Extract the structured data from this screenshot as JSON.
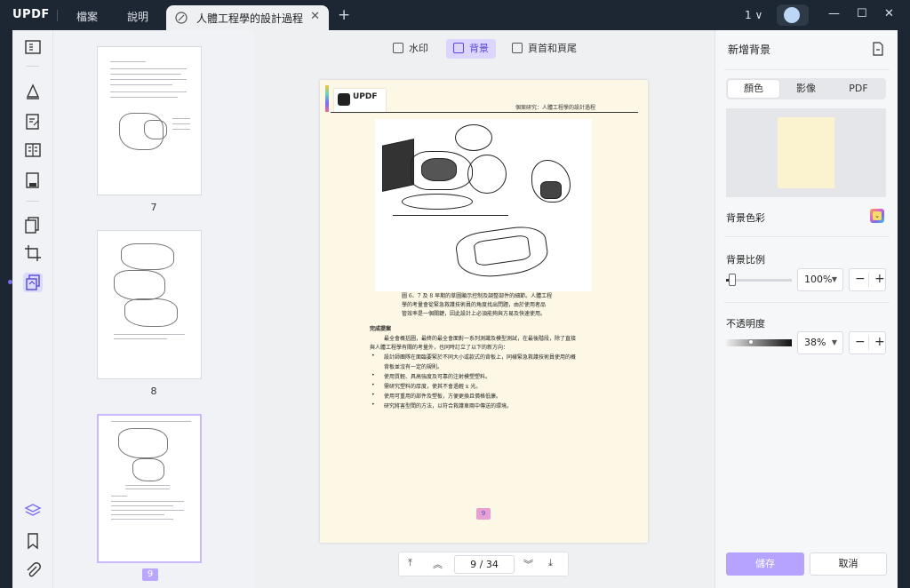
{
  "titlebar": {
    "logo": "UPDF",
    "menu": [
      "檔案",
      "說明"
    ],
    "tab_title": "人體工程學的設計過程",
    "page_count": "1 ∨"
  },
  "thumbnails": [
    {
      "label": "7"
    },
    {
      "label": "8"
    },
    {
      "label": "9"
    }
  ],
  "page_tabs": {
    "watermark": "水印",
    "background": "背景",
    "header_footer": "頁首和頁尾"
  },
  "document": {
    "logo_text": "UPDF",
    "header": "個案研究：人體工程學的設計過程",
    "caption": [
      "圖 6、7 及 8  早期的草圖顯示控制及調整部件的細節。人體工程",
      "學的考量會從緊急救護技術員的角度找出問題，由於使用者品",
      "管效率是一個關鍵，因此設計上必須能夠與方易及快速使用。"
    ],
    "section_title": "完成提案",
    "paragraph": [
      "最全會概括圖，最終的最全會面對一系列測識及模型測試，在最後階段，除了直接",
      "與人體工程學有關的考量外，也同時訂立了以下的新方向："
    ],
    "bullets": [
      "設計師團隊在面臨要緊於不同大小或款式的背板上，同樣緊急救護技術員使用的概",
      "使用質輕、具高強度及可靠的注射模塑塑料。",
      "需研究塑料的厚度，使其不會過輕 x 光。",
      "使用可重用的部件及塑板，方便更換且價格低廉。",
      "研究將害型間的方法，以符合救護車兩中傳送的環境。"
    ],
    "bullet_cont": "背板並沒有一定的規則。",
    "page_number": "9"
  },
  "pagination": {
    "current": "9",
    "separator": "/",
    "total": "34"
  },
  "right_panel": {
    "title": "新增背景",
    "segments": [
      "顏色",
      "影像",
      "PDF"
    ],
    "active_segment": "顏色",
    "color_label": "背景色彩",
    "scale_label": "背景比例",
    "scale_value": "100%",
    "scale_fraction": 0.1,
    "opacity_label": "不透明度",
    "opacity_value": "38%",
    "opacity_fraction": 0.38,
    "save": "儲存",
    "cancel": "取消"
  },
  "colors": {
    "accent": "#7a6cf0",
    "page_background": "#fdf8e6",
    "save_button": "#b5a3ff"
  }
}
